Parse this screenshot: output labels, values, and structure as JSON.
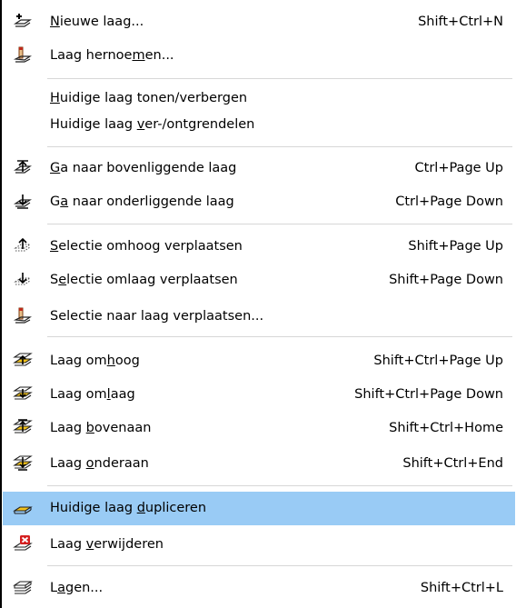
{
  "menu": {
    "items": [
      {
        "id": "new-layer",
        "pre": "",
        "mn": "N",
        "post": "ieuwe laag...",
        "shortcut": "Shift+Ctrl+N",
        "icon": "new-layer-icon"
      },
      {
        "id": "rename-layer",
        "pre": "Laag hernoe",
        "mn": "m",
        "post": "en...",
        "shortcut": "",
        "icon": "rename-layer-icon"
      },
      {
        "id": "toggle-visibility",
        "pre": "",
        "mn": "H",
        "post": "uidige laag tonen/verbergen",
        "shortcut": "",
        "icon": ""
      },
      {
        "id": "toggle-lock",
        "pre": "Huidige laag ",
        "mn": "v",
        "post": "er-/ontgrendelen",
        "shortcut": "",
        "icon": ""
      },
      {
        "id": "goto-layer-above",
        "pre": "",
        "mn": "G",
        "post": "a naar bovenliggende laag",
        "shortcut": "Ctrl+Page Up",
        "icon": "go-layer-up-icon"
      },
      {
        "id": "goto-layer-below",
        "pre": "G",
        "mn": "a",
        "post": " naar onderliggende laag",
        "shortcut": "Ctrl+Page Down",
        "icon": "go-layer-down-icon"
      },
      {
        "id": "move-selection-up",
        "pre": "",
        "mn": "S",
        "post": "electie omhoog verplaatsen",
        "shortcut": "Shift+Page Up",
        "icon": "move-selection-up-icon"
      },
      {
        "id": "move-selection-down",
        "pre": "S",
        "mn": "e",
        "post": "lectie omlaag verplaatsen",
        "shortcut": "Shift+Page Down",
        "icon": "move-selection-down-icon"
      },
      {
        "id": "move-selection-to-layer",
        "pre": "Selectie naar laag verplaatsen...",
        "mn": "",
        "post": "",
        "shortcut": "",
        "icon": "move-selection-to-layer-icon"
      },
      {
        "id": "raise-layer",
        "pre": "Laag om",
        "mn": "h",
        "post": "oog",
        "shortcut": "Shift+Ctrl+Page Up",
        "icon": "raise-layer-icon"
      },
      {
        "id": "lower-layer",
        "pre": "Laag om",
        "mn": "l",
        "post": "aag",
        "shortcut": "Shift+Ctrl+Page Down",
        "icon": "lower-layer-icon"
      },
      {
        "id": "layer-to-top",
        "pre": "Laag ",
        "mn": "b",
        "post": "ovenaan",
        "shortcut": "Shift+Ctrl+Home",
        "icon": "layer-to-top-icon"
      },
      {
        "id": "layer-to-bottom",
        "pre": "Laag ",
        "mn": "o",
        "post": "nderaan",
        "shortcut": "Shift+Ctrl+End",
        "icon": "layer-to-bottom-icon"
      },
      {
        "id": "duplicate-layer",
        "pre": "Huidige laag ",
        "mn": "d",
        "post": "upliceren",
        "shortcut": "",
        "icon": "duplicate-layer-icon"
      },
      {
        "id": "delete-layer",
        "pre": "Laag ",
        "mn": "v",
        "post": "erwijderen",
        "shortcut": "",
        "icon": "delete-layer-icon"
      },
      {
        "id": "layers-dialog",
        "pre": "L",
        "mn": "a",
        "post": "gen...",
        "shortcut": "Shift+Ctrl+L",
        "icon": "layers-icon"
      }
    ]
  },
  "colors": {
    "highlight": "#99cbf5",
    "separator": "#d7d7d7",
    "accent_yellow": "#f2c21b",
    "accent_red": "#d41f1f"
  }
}
